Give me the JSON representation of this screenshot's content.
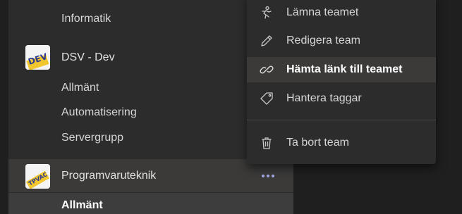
{
  "sidebar": {
    "top_channel": "Informatik",
    "teams": [
      {
        "name": "DSV - Dev",
        "icon_text": "DEV",
        "channels": [
          "Allmänt",
          "Automatisering",
          "Servergrupp"
        ]
      },
      {
        "name": "Programvaruteknik",
        "icon_text": "TPVAC",
        "channels": [
          "Allmänt"
        ]
      }
    ]
  },
  "context_menu": {
    "items": [
      {
        "label": "Lämna teamet",
        "icon": "leave-team-icon"
      },
      {
        "label": "Redigera team",
        "icon": "pencil-icon"
      },
      {
        "label": "Hämta länk till teamet",
        "icon": "link-icon",
        "active": true
      },
      {
        "label": "Hantera taggar",
        "icon": "tag-icon"
      },
      {
        "label": "Ta bort team",
        "icon": "trash-icon"
      }
    ]
  },
  "colors": {
    "panel": "#2d2c2c",
    "hover": "#3b3a39",
    "accent_dots": "#a7abe7"
  }
}
